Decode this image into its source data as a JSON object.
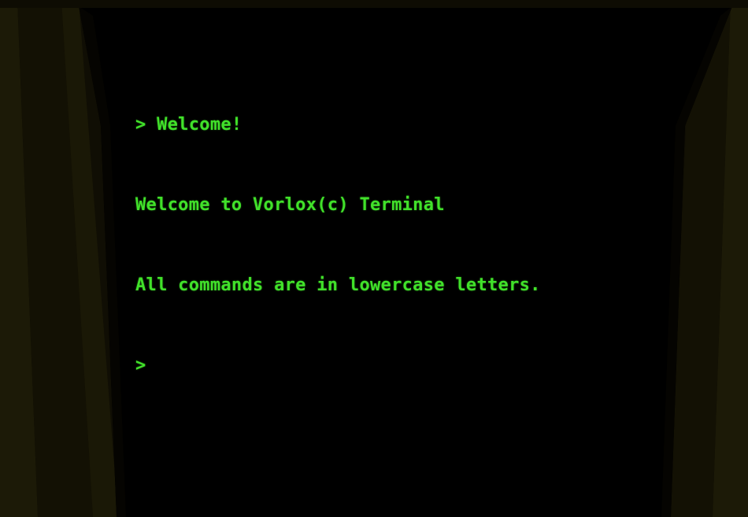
{
  "terminal": {
    "lines": [
      "> Welcome!",
      "Welcome to Vorlox(c) Terminal",
      "All commands are in lowercase letters."
    ],
    "prompt": ">",
    "input_value": ""
  },
  "colors": {
    "text": "#41e12a",
    "screen_background": "#000000",
    "frame": "#1a1806"
  }
}
